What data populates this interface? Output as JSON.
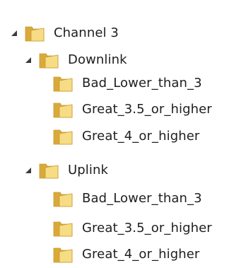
{
  "tree": {
    "root": {
      "label": "Channel 3",
      "expanded": true,
      "children": [
        {
          "label": "Downlink",
          "expanded": true,
          "children": [
            {
              "label": "Bad_Lower_than_3"
            },
            {
              "label": "Great_3.5_or_higher"
            },
            {
              "label": "Great_4_or_higher"
            }
          ]
        },
        {
          "label": "Uplink",
          "expanded": true,
          "children": [
            {
              "label": "Bad_Lower_than_3"
            },
            {
              "label": "Great_3.5_or_higher"
            },
            {
              "label": "Great_4_or_higher"
            }
          ]
        }
      ]
    }
  },
  "icons": {
    "expanded": "triangle-down-icon",
    "folder": "folder-icon"
  },
  "colors": {
    "expander": "#3c3c3c",
    "folder_back": "#d9a93a",
    "folder_front": "#f6dc84",
    "folder_edge": "#c89a2e"
  }
}
